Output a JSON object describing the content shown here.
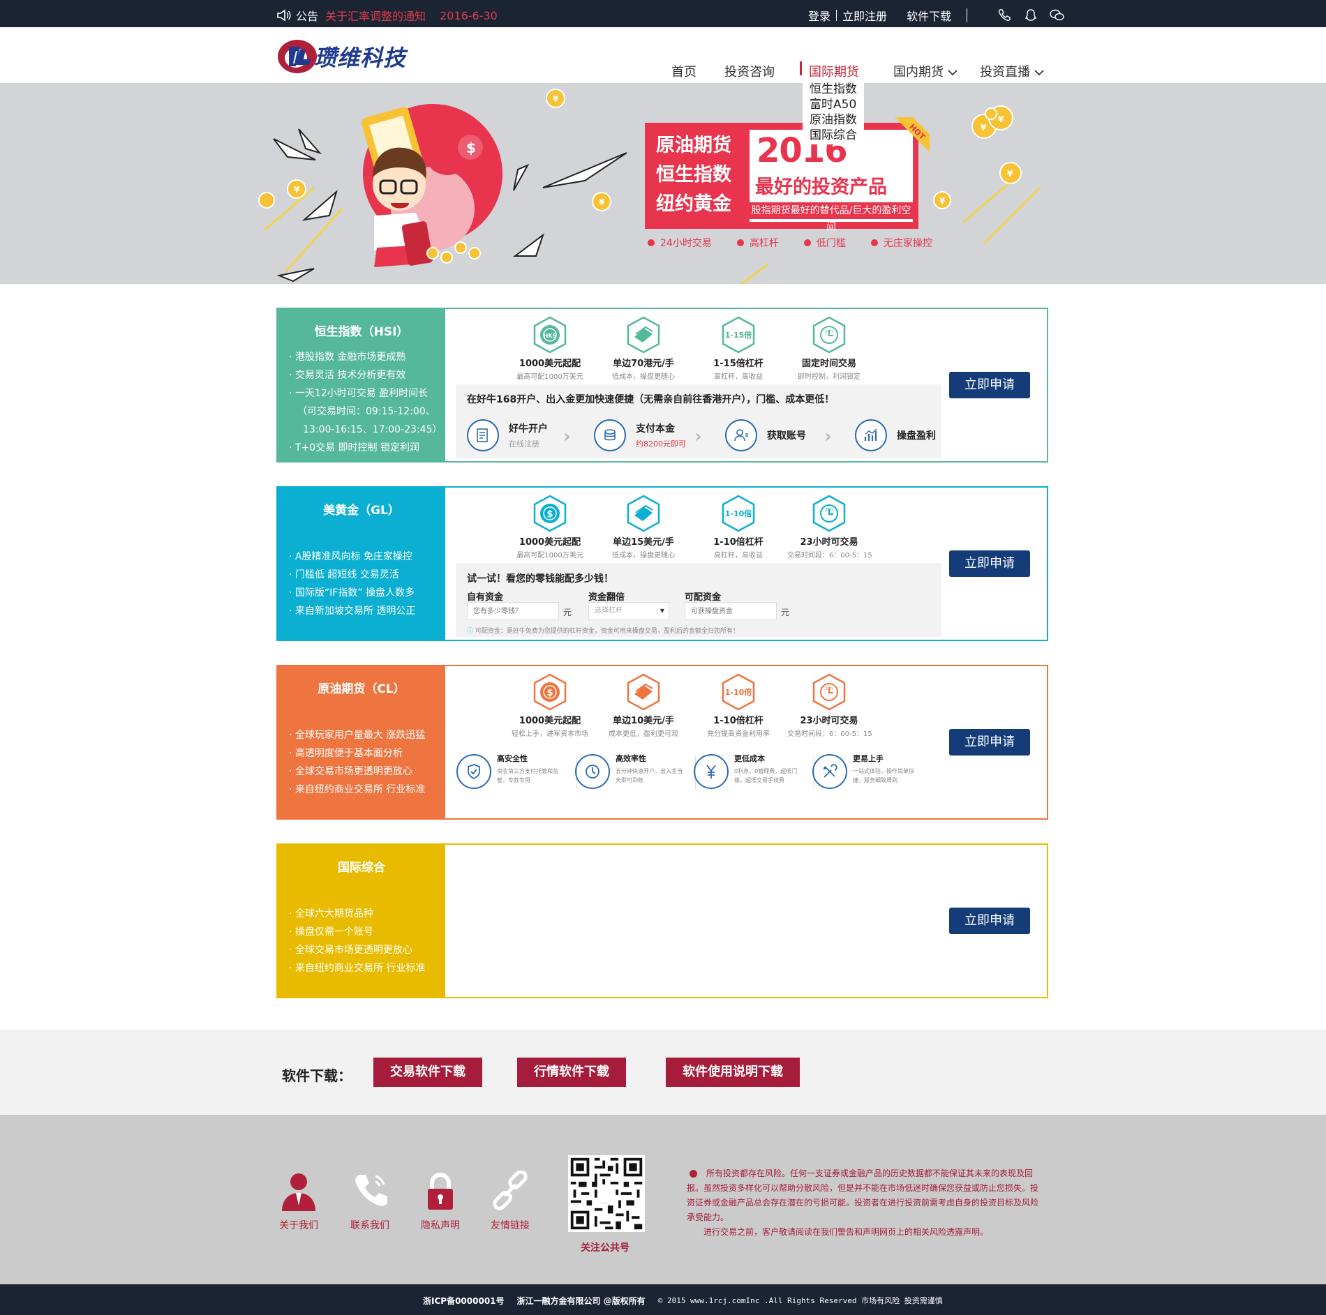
{
  "topbar": {
    "notice_label": "公告",
    "notice_link": "关于汇率调整的通知",
    "notice_date": "2016-6-30",
    "login": "登录",
    "register": "立即注册",
    "software": "软件下载"
  },
  "header": {
    "logo_text": "瓒维科技",
    "nav": [
      "首页",
      "投资咨询",
      "国际期货",
      "国内期货",
      "投资直播"
    ],
    "dropdown": [
      "恒生指数",
      "富时A50",
      "原油指数",
      "国际综合"
    ]
  },
  "banner": {
    "promo_left": [
      "原油期货",
      "恒生指数",
      "纽约黄金"
    ],
    "year": "2016",
    "best": "最好的投资产品",
    "sub": "股指期货最好的替代品/巨大的盈利空间",
    "hot": "HOT",
    "features": [
      "24小时交易",
      "高杠杆",
      "低门槛",
      "无庄家操控"
    ]
  },
  "colors": {
    "hsi": "#55b89b",
    "gold": "#0aafd2",
    "oil": "#ef7540",
    "intl": "#e8bb00",
    "accent": "#a51d3a",
    "navy": "#133c78"
  },
  "cards": {
    "apply_label": "立即申请",
    "hsi": {
      "title": "恒生指数（HSI）",
      "bullets": [
        "港股指数 金融市场更成熟",
        "交易灵活 技术分析更有效",
        "一天12小时可交易  盈利时间长",
        "（可交易时间：09:15-12:00、",
        "13:00-16:15、17:00-23:45）",
        "T+0交易 即时控制 锁定利润"
      ],
      "features": [
        {
          "icon": "hks-icon",
          "glyph": "HKS",
          "title": "1000美元起配",
          "sub": "最高可配1000万美元"
        },
        {
          "icon": "money-icon",
          "glyph": "",
          "title": "单边70港元/手",
          "sub": "低成本，操盘更随心"
        },
        {
          "icon": "leverage-icon",
          "glyph": "1-15倍",
          "title": "1-15倍杠杆",
          "sub": "高杠杆，高收益"
        },
        {
          "icon": "clock-icon",
          "glyph": "24h",
          "title": "固定时间交易",
          "sub": "即时控制，利润锁定"
        }
      ],
      "process_head": "在好牛168开户、出入金更加快速便捷（无需亲自前往香港开户），门槛、成本更低！",
      "steps": [
        {
          "title": "好牛开户",
          "sub": "在线注册"
        },
        {
          "title": "支付本金",
          "sub": "约8200元即可"
        },
        {
          "title": "获取账号",
          "sub": ""
        },
        {
          "title": "操盘盈利",
          "sub": ""
        }
      ]
    },
    "gold": {
      "title": "美黄金（GL）",
      "bullets": [
        "A股精准风向标 免庄家操控",
        "门槛低 超短线 交易灵活",
        "国际版“IF指数” 操盘人数多",
        "来自新加坡交易所 透明公正"
      ],
      "features": [
        {
          "icon": "dollar-icon",
          "glyph": "$",
          "title": "1000美元起配",
          "sub": "最高可配1000万美元"
        },
        {
          "icon": "money-icon",
          "glyph": "",
          "title": "单边15美元/手",
          "sub": "低成本，操盘更随心"
        },
        {
          "icon": "leverage-icon",
          "glyph": "1-10倍",
          "title": "1-10倍杠杆",
          "sub": "高杠杆，高收益"
        },
        {
          "icon": "clock-icon",
          "glyph": "23h",
          "title": "23小时可交易",
          "sub": "交易时间段：6：00-5：15"
        }
      ],
      "calc": {
        "head": "试一试！看您的零钱能配多少钱！",
        "own_label": "自有资金",
        "own_placeholder": "您有多少零钱？",
        "unit": "元",
        "multiple_label": "资金翻倍",
        "multiple_value": "选择杠杆",
        "available_label": "可配资金",
        "available_placeholder": "可获操盘资金",
        "note": "可配资金：是好牛免费为您提供的杠杆资金，资金可用来操盘交易，盈利后的金额全归您所有！"
      }
    },
    "oil": {
      "title": "原油期货（CL）",
      "bullets": [
        "全球玩家用户量最大 涨跌迅猛",
        "高透明度便于基本面分析",
        "全球交易市场更透明更放心",
        "来自纽约商业交易所 行业标准"
      ],
      "features": [
        {
          "icon": "dollar-icon",
          "glyph": "$",
          "title": "1000美元起配",
          "sub": "轻松上手，进军资本市场"
        },
        {
          "icon": "money-icon",
          "glyph": "",
          "title": "单边10美元/手",
          "sub": "成本更低，盈利更可观"
        },
        {
          "icon": "leverage-icon",
          "glyph": "1-10倍",
          "title": "1-10倍杠杆",
          "sub": "充分提高资金利用率"
        },
        {
          "icon": "clock-icon",
          "glyph": "23h",
          "title": "23小时可交易",
          "sub": "交易时间段：6：00-5：15"
        }
      ],
      "advantages": [
        {
          "icon": "shield-icon",
          "title": "高安全性",
          "desc": "资金第三方支付托管和监管，专款专用"
        },
        {
          "icon": "clock-icon",
          "title": "高效率性",
          "desc": "五分钟快速开户，出入金当天即可到账"
        },
        {
          "icon": "yuan-icon",
          "title": "更低成本",
          "desc": "0利息，0管理费，超低门槛，超低交易手续费"
        },
        {
          "icon": "tools-icon",
          "title": "更易上手",
          "desc": "一站式体验，操作简单快捷，服务细致周到"
        }
      ]
    },
    "intl": {
      "title": "国际综合",
      "bullets": [
        "全球六大期货品种",
        "操盘仅需一个账号",
        "全球交易市场更透明更放心",
        "来自纽约商业交易所 行业标准"
      ]
    }
  },
  "download": {
    "label": "软件下载：",
    "buttons": [
      "交易软件下载",
      "行情软件下载",
      "软件使用说明下载"
    ]
  },
  "footer": {
    "links": [
      "关于我们",
      "联系我们",
      "隐私声明",
      "友情链接"
    ],
    "qr_label": "关注公共号",
    "risk_p1": "所有投资都存在风险。任何一支证券或金融产品的历史数据都不能保证其未来的表现及回报。虽然投资多样化可以帮助分散风险，但是并不能在市场低迷时确保您获益或防止您损失。投资证券或金融产品总会存在潜在的亏损可能。投资者在进行投资前需考虑自身的投资目标及风险承受能力。",
    "risk_p2": "进行交易之前，客户敬请阅读在我们警告和声明网页上的相关风险透露声明。",
    "icp": "浙ICP备0000001号",
    "company": "浙江一融方金有限公司 @版权所有",
    "copyright": "© 2015 www.1rcj.comInc .All Rights Reserved 市场有风险 投资需谨慎"
  }
}
